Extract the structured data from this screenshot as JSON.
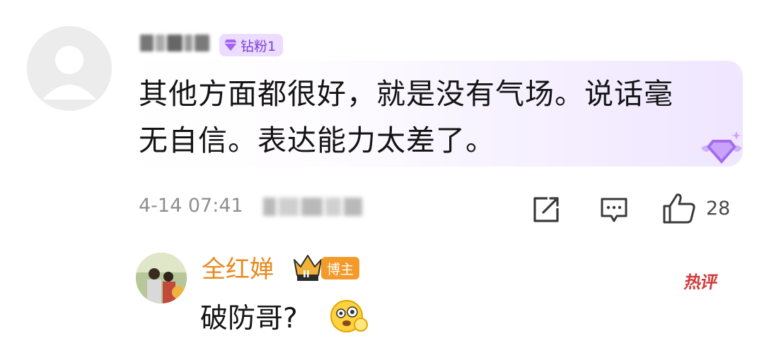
{
  "comment": {
    "avatar_icon": "default-user-avatar",
    "fan_badge_label": "钻粉1",
    "fan_badge_icon": "diamond-icon",
    "text_line1": "其他方面都很好，就是没有气场。说话毫",
    "text_line2": "无自信。表达能力太差了。",
    "timestamp": "4-14 07:41",
    "like_count": "28",
    "level_emblem_icon": "diamond-wings-emblem-icon"
  },
  "actions": {
    "share_icon": "share-icon",
    "reply_icon": "comment-bubble-icon",
    "like_icon": "thumbs-up-icon"
  },
  "reply": {
    "username": "全红婵",
    "role_badge": "博主",
    "crown_level": "II",
    "text": "破防哥?",
    "emoji": "emoji-sticker",
    "hot_label": "热评"
  },
  "colors": {
    "accent_purple": "#7b3fd8",
    "badge_purple_bg": "#ecdcff",
    "reply_name_orange": "#e8891c",
    "blogger_badge": "#f39a2a",
    "hot_red": "#d23b3b"
  }
}
